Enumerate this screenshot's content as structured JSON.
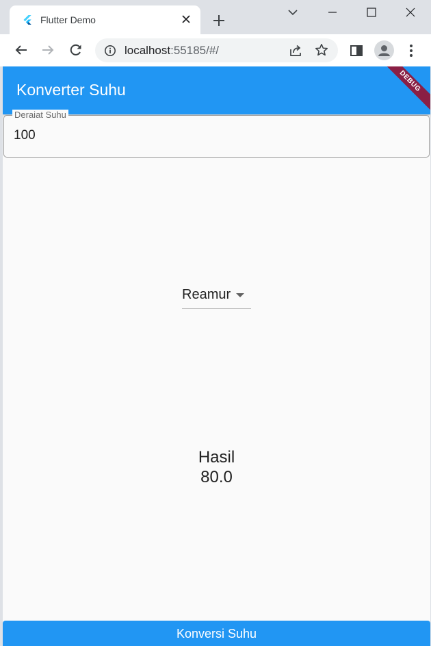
{
  "browser": {
    "tab": {
      "title": "Flutter Demo"
    },
    "url": {
      "host": "localhost",
      "rest": ":55185/#/"
    }
  },
  "app": {
    "title": "Konverter Suhu",
    "debug_banner": "DEBUG",
    "input": {
      "label": "Derajat Suhu",
      "value": "100"
    },
    "dropdown": {
      "selected": "Reamur"
    },
    "result": {
      "label": "Hasil",
      "value": "80.0"
    },
    "button_label": "Konversi Suhu"
  },
  "colors": {
    "primary": "#2196f3",
    "debug_banner": "#8a1f45",
    "chrome_frame": "#dee1e6"
  }
}
